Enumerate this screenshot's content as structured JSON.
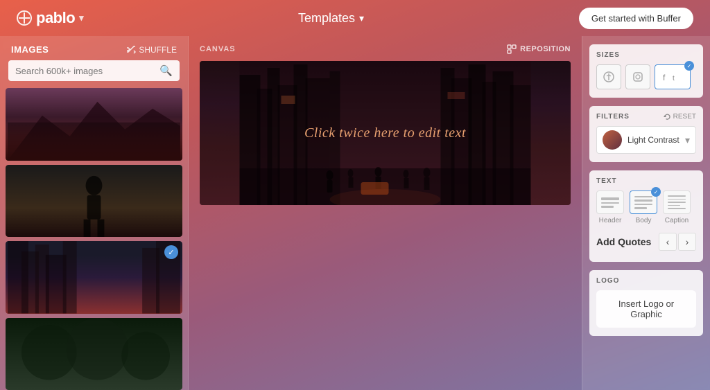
{
  "topnav": {
    "logo_text": "pablo",
    "templates_label": "Templates",
    "cta_button": "Get started with Buffer"
  },
  "left_panel": {
    "title": "IMAGES",
    "shuffle_label": "SHUFFLE",
    "search_placeholder": "Search 600k+ images",
    "images": [
      {
        "id": 1,
        "alt": "Mountain lake with stormy sky",
        "selected": false
      },
      {
        "id": 2,
        "alt": "Person standing on rubble",
        "selected": false
      },
      {
        "id": 3,
        "alt": "City street at night",
        "selected": true
      },
      {
        "id": 4,
        "alt": "Forest with bokeh",
        "selected": false
      }
    ]
  },
  "canvas": {
    "label": "CANVAS",
    "reposition_label": "REPOSITION",
    "edit_text": "Click twice here to edit text"
  },
  "right_panel": {
    "sizes_title": "SIZES",
    "sizes": [
      {
        "id": "pinterest",
        "label": "P",
        "icon": "pinterest-icon",
        "active": false
      },
      {
        "id": "instagram",
        "label": "○",
        "icon": "instagram-icon",
        "active": false
      },
      {
        "id": "facebook-twitter",
        "label": "f t",
        "icon": "facebook-twitter-icon",
        "active": true
      }
    ],
    "filters_title": "FILTERS",
    "reset_label": "RESET",
    "active_filter": "Light Contrast",
    "text_title": "TEXT",
    "text_options": [
      {
        "id": "header",
        "label": "Header",
        "active": false
      },
      {
        "id": "body",
        "label": "Body",
        "active": true
      },
      {
        "id": "caption",
        "label": "Caption",
        "active": false
      }
    ],
    "add_quotes_label": "Add Quotes",
    "logo_title": "LOGO",
    "logo_insert_label": "Insert Logo or Graphic"
  }
}
